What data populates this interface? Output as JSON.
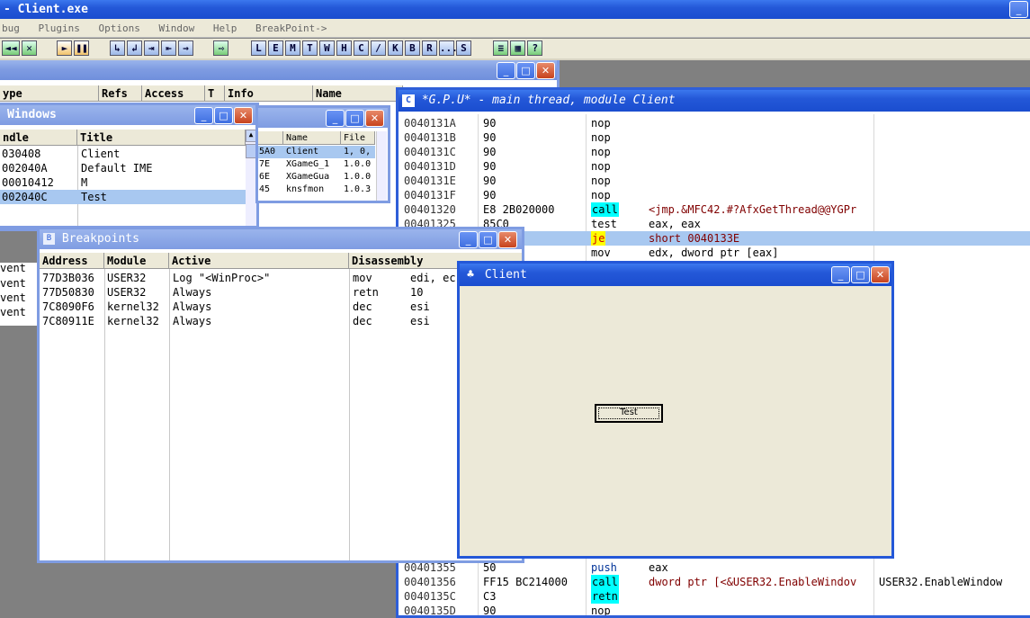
{
  "app": {
    "title": "- Client.exe"
  },
  "menu": [
    "bug",
    "Plugins",
    "Options",
    "Window",
    "Help",
    "BreakPoint->"
  ],
  "toolbar": {
    "group1": [
      "◄◄",
      "✕"
    ],
    "group2": [
      "►",
      "❚❚"
    ],
    "group3": [
      "↳",
      "↲",
      "⇥",
      "⇤",
      "→"
    ],
    "group4": [
      "⇨"
    ],
    "letters": [
      "L",
      "E",
      "M",
      "T",
      "W",
      "H",
      "C",
      "/",
      "K",
      "B",
      "R",
      "...",
      "S"
    ],
    "group5": [
      "≡",
      "▦",
      "?"
    ]
  },
  "memwin": {
    "cols": [
      "ype",
      "Refs",
      "Access",
      "T",
      "Info",
      "Name"
    ]
  },
  "windows": {
    "title": "Windows",
    "cols": [
      "ndle",
      "Title"
    ],
    "rows": [
      [
        "030408",
        "Client"
      ],
      [
        "002040A",
        "Default IME"
      ],
      [
        "00010412",
        "M"
      ],
      [
        "002040C",
        "Test"
      ]
    ],
    "side": [
      "vent",
      "vent",
      "vent",
      "vent"
    ]
  },
  "modules": {
    "cols": [
      "",
      "Name",
      "File"
    ],
    "rows": [
      [
        "5A0",
        "Client",
        "1, 0,"
      ],
      [
        "7E",
        "XGameG_1",
        "1.0.0"
      ],
      [
        "6E",
        "XGameGua",
        "1.0.0"
      ],
      [
        "45",
        "knsfmon",
        "1.0.3"
      ]
    ]
  },
  "cpu": {
    "title": "*G.P.U* - main thread, module Client",
    "rows": [
      [
        "0040131A",
        "90",
        "nop",
        "",
        ""
      ],
      [
        "0040131B",
        "90",
        "nop",
        "",
        ""
      ],
      [
        "0040131C",
        "90",
        "nop",
        "",
        ""
      ],
      [
        "0040131D",
        "90",
        "nop",
        "",
        ""
      ],
      [
        "0040131E",
        "90",
        "nop",
        "",
        ""
      ],
      [
        "0040131F",
        "90",
        "nop",
        "",
        ""
      ],
      [
        "00401320",
        "E8 2B020000",
        "call",
        "<jmp.&MFC42.#?AfxGetThread@@YGPr",
        ""
      ],
      [
        "00401325",
        "85C0",
        "test",
        "eax, eax",
        ""
      ],
      [
        "",
        "",
        "je",
        "short 0040133E",
        ""
      ],
      [
        "",
        "",
        "mov",
        "edx, dword ptr [eax]",
        ""
      ]
    ],
    "bottom_rows": [
      [
        "00401355",
        "50",
        "push",
        "eax",
        ""
      ],
      [
        "00401356",
        "FF15 BC214000",
        "call",
        "dword ptr [<&USER32.EnableWindov",
        "USER32.EnableWindow"
      ],
      [
        "0040135C",
        "C3",
        "retn",
        "",
        ""
      ],
      [
        "0040135D",
        "90",
        "nop",
        "",
        ""
      ]
    ]
  },
  "breakpoints": {
    "title": "Breakpoints",
    "cols": [
      "Address",
      "Module",
      "Active",
      "Disassembly"
    ],
    "rows": [
      [
        "77D3B036",
        "USER32",
        "Log \"<WinProc>\"",
        "mov",
        "edi, ec"
      ],
      [
        "77D50830",
        "USER32",
        "Always",
        "retn",
        "10"
      ],
      [
        "7C8090F6",
        "kernel32",
        "Always",
        "dec",
        "esi"
      ],
      [
        "7C80911E",
        "kernel32",
        "Always",
        "dec",
        "esi"
      ]
    ]
  },
  "client": {
    "title": "Client",
    "button": "Test"
  },
  "colors": {
    "accent": "#2458d8",
    "highlight": "#00ffff",
    "jump": "#ffff00",
    "sel": "#a8c8f0"
  }
}
